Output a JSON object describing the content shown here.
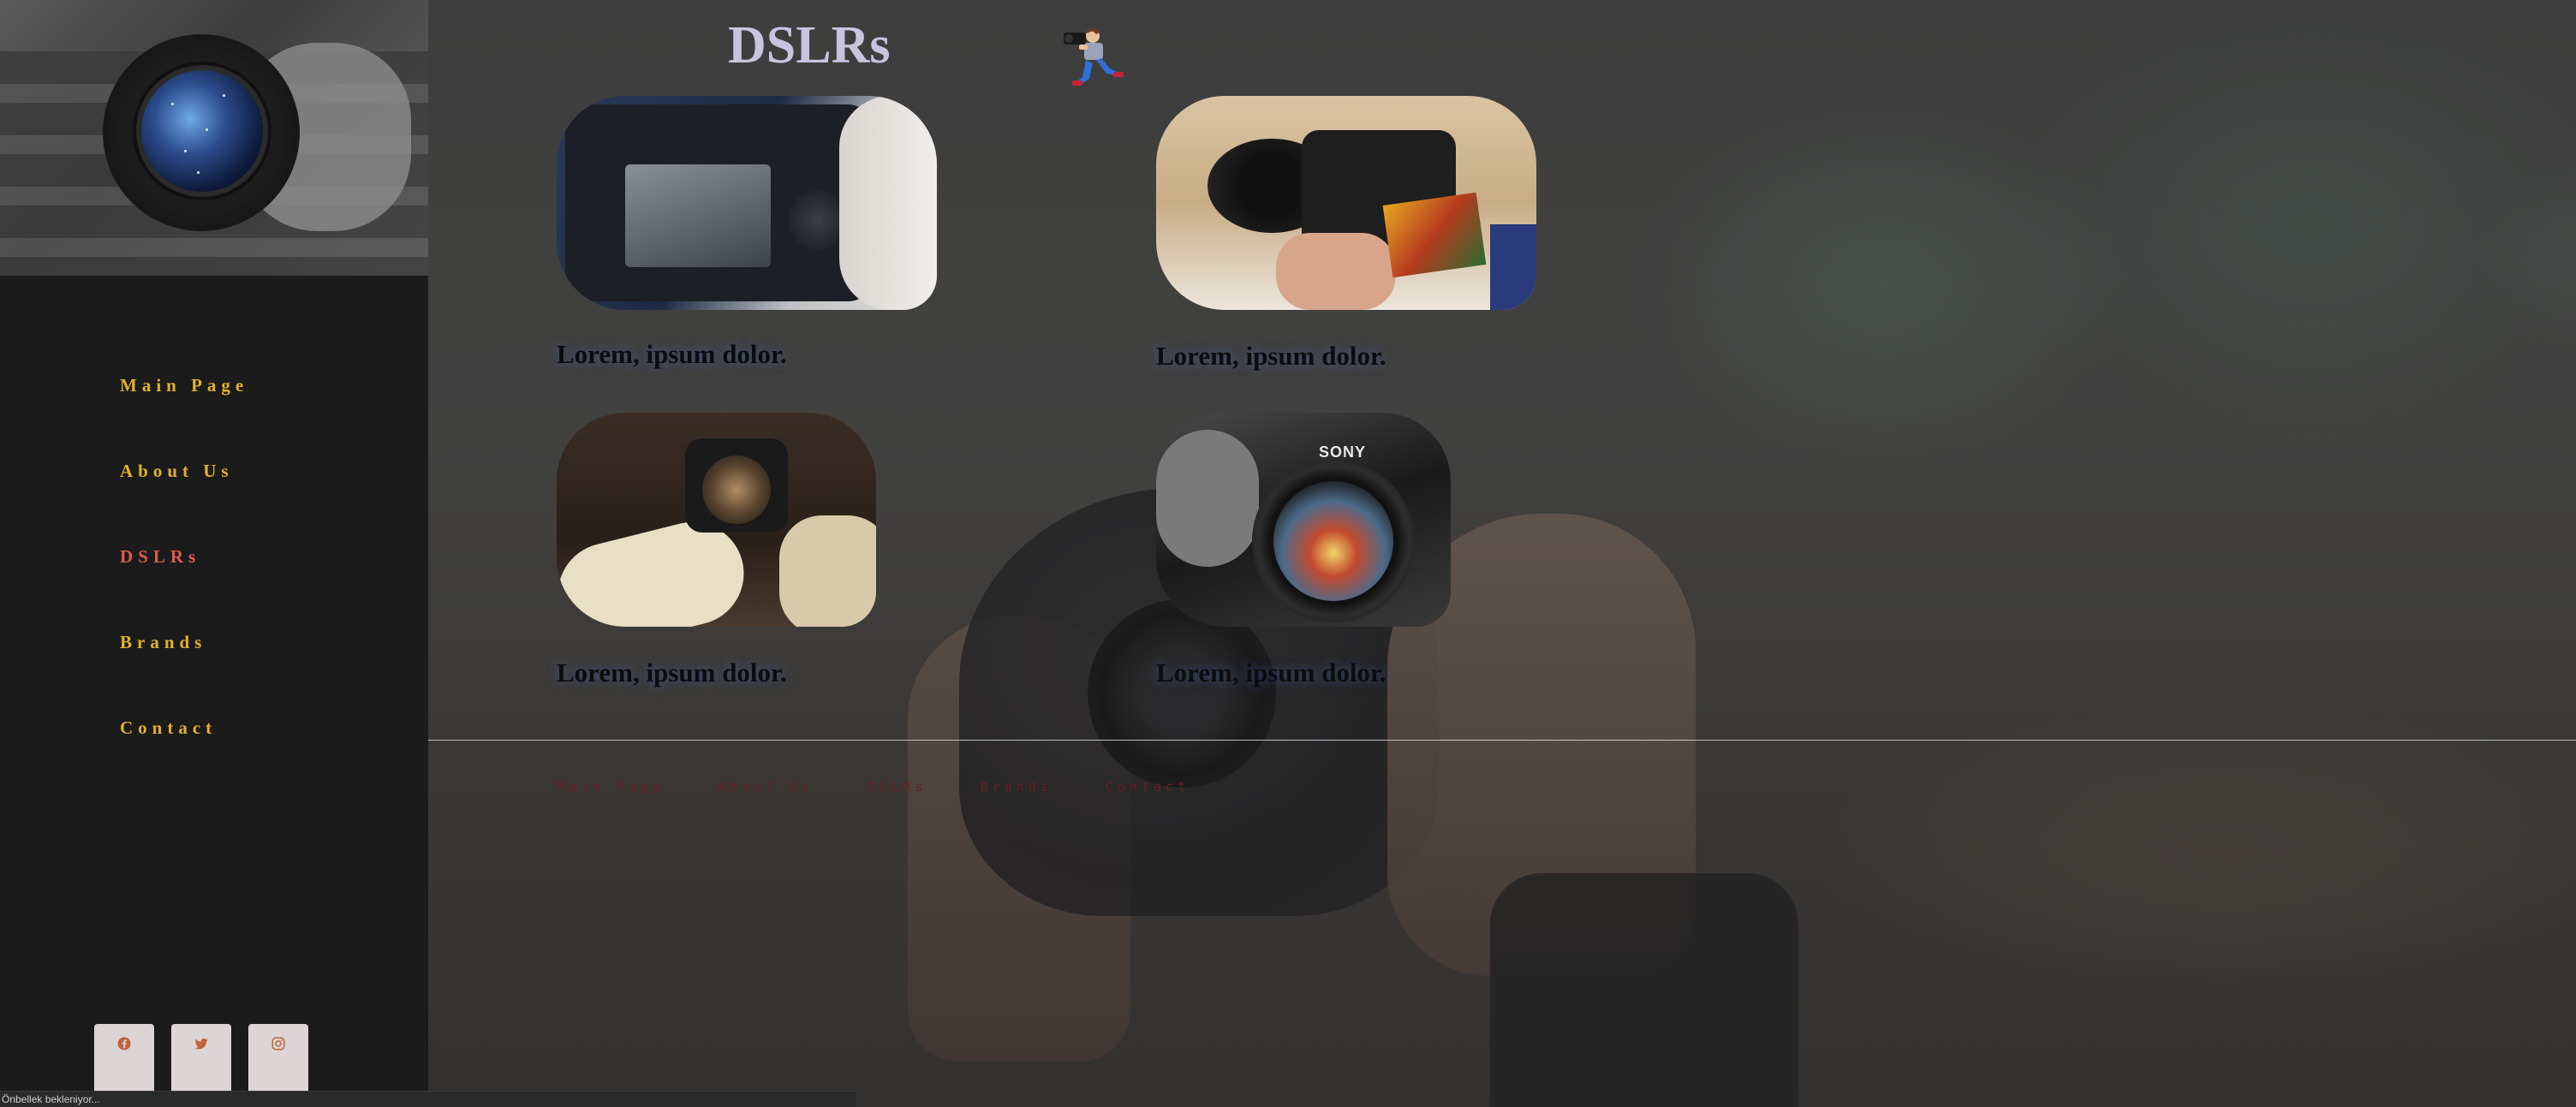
{
  "page": {
    "title": "DSLRs"
  },
  "sidebar": {
    "nav": [
      {
        "label": "Main Page",
        "active": false
      },
      {
        "label": "About Us",
        "active": false
      },
      {
        "label": "DSLRs",
        "active": true
      },
      {
        "label": "Brands",
        "active": false
      },
      {
        "label": "Contact",
        "active": false
      }
    ],
    "social": [
      {
        "icon": "facebook-icon"
      },
      {
        "icon": "twitter-icon"
      },
      {
        "icon": "instagram-icon"
      }
    ]
  },
  "cards": [
    {
      "caption": "Lorem, ipsum dolor."
    },
    {
      "caption": "Lorem, ipsum dolor."
    },
    {
      "caption": "Lorem, ipsum dolor."
    },
    {
      "caption": "Lorem, ipsum dolor."
    }
  ],
  "footer": {
    "nav": [
      "Main Page",
      "About Us",
      "DSLRs",
      "Brands",
      "Contact"
    ]
  },
  "status_bar": {
    "text": "Önbellek bekleniyor..."
  },
  "colors": {
    "nav_text": "#e1b12c",
    "nav_active": "#e05a4f",
    "title": "#c9c3de",
    "footer_link": "#6b1f24",
    "sidebar_bg": "#1b1b1c",
    "social_btn": "#ddd5d5",
    "social_icon": "#c0623a"
  }
}
